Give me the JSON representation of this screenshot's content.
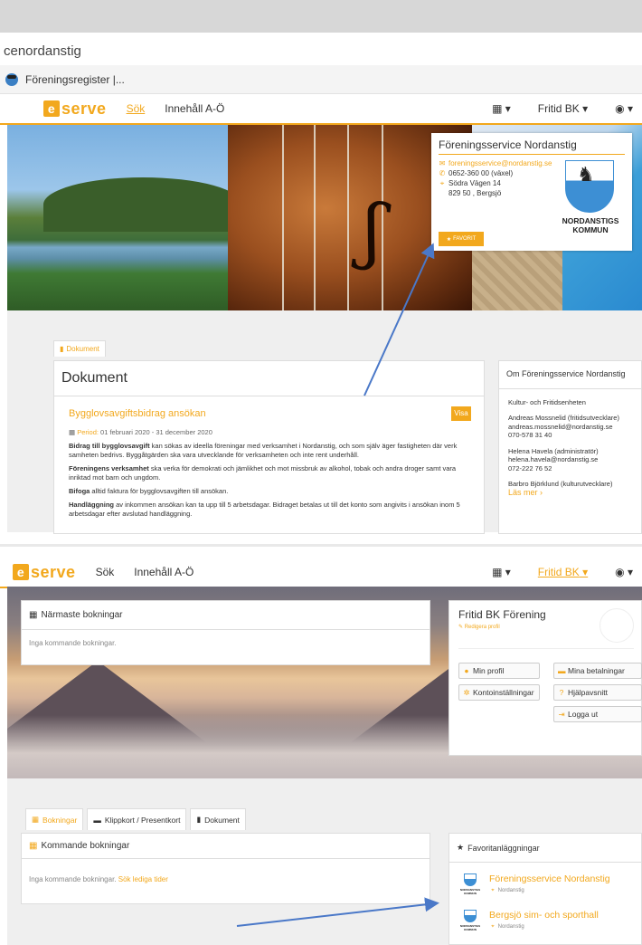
{
  "browser": {
    "url_fragment": "cenordanstig",
    "tab_label": "Föreningsregister |..."
  },
  "nav1": {
    "logo_letter": "e",
    "logo_word": "serve",
    "links": [
      "Sök",
      "Innehåll A-Ö"
    ],
    "active_link": "Sök",
    "user_menu": "Fritid BK",
    "calendar_icon": "calendar-icon",
    "globe_icon": "globe-icon"
  },
  "infobox": {
    "title": "Föreningsservice Nordanstig",
    "email": "foreningsservice@nordanstig.se",
    "phone": "0652-360 00 (växel)",
    "street": "Södra Vägen 14",
    "postal": "829 50 , Bergsjö",
    "favorite_label": "FAVORIT",
    "kommun_line1": "NORDANSTIGS",
    "kommun_line2": "KOMMUN"
  },
  "documents": {
    "tab_label": "Dokument",
    "heading": "Dokument",
    "item_title": "Bygglovsavgiftsbidrag ansökan",
    "visa_label": "Visa",
    "period_label": "Period:",
    "period_value": "01 februari 2020 - 31 december 2020",
    "p1_bold": "Bidrag till bygglovsavgift",
    "p1_rest": " kan sökas av ideella föreningar med verksamhet i Nordanstig, och som själv äger fastigheten där verk samheten bedrivs. Byggåtgärden ska vara utvecklande för verksamheten och inte rent underhåll.",
    "p2_bold": "Föreningens verksamhet",
    "p2_rest": " ska verka för demokrati och jämlikhet och mot missbruk av alkohol, tobak och andra droger samt vara inriktad mot barn och ungdom.",
    "p3_bold": "Bifoga",
    "p3_rest": " alltid faktura för bygglovsavgiften till ansökan.",
    "p4_bold": "Handläggning",
    "p4_rest": " av inkommen ansökan kan ta upp till 5 arbetsdagar. Bidraget betalas ut till det konto som angivits i ansökan inom 5 arbetsdagar efter avslutad handläggning."
  },
  "om": {
    "heading": "Om Föreningsservice Nordanstig",
    "unit": "Kultur- och Fritidsenheten",
    "c1_name": "Andreas Mossnelid (fritidsutvecklare)",
    "c1_mail": "andreas.mossnelid@nordanstig.se",
    "c1_phone": "070-578 31 40",
    "c2_name": "Helena Havela (administratör)",
    "c2_mail": "helena.havela@nordanstig.se",
    "c2_phone": "072-222 76 52",
    "c3_name": "Barbro Björklund (kulturutvecklare)",
    "read_more": "Läs mer"
  },
  "nav2": {
    "logo_letter": "e",
    "logo_word": "serve",
    "links": [
      "Sök",
      "Innehåll A-Ö"
    ],
    "user_menu": "Fritid BK"
  },
  "bookings": {
    "heading": "Närmaste bokningar",
    "empty": "Inga kommande bokningar."
  },
  "profile": {
    "name": "Fritid BK Förening",
    "edit": "Redigera profil",
    "buttons": {
      "my_profile": "Min profil",
      "payments": "Mina betalningar",
      "account": "Kontoinställningar",
      "help": "Hjälpavsnitt",
      "logout": "Logga ut"
    }
  },
  "tabs2": {
    "bookings": "Bokningar",
    "cards": "Klippkort / Presentkort",
    "docs": "Dokument"
  },
  "upcoming": {
    "heading": "Kommande bokningar",
    "empty": "Inga kommande bokningar.",
    "link": "Sök lediga tider"
  },
  "favorites": {
    "heading": "Favoritanläggningar",
    "items": [
      {
        "name": "Föreningsservice Nordanstig",
        "place": "Nordanstig"
      },
      {
        "name": "Bergsjö sim- och sporthall",
        "place": "Nordanstig"
      }
    ],
    "mini_label": "NORDANSTIGS KOMMUN"
  },
  "colors": {
    "accent": "#f2a81d",
    "arrow": "#4a78c8"
  }
}
